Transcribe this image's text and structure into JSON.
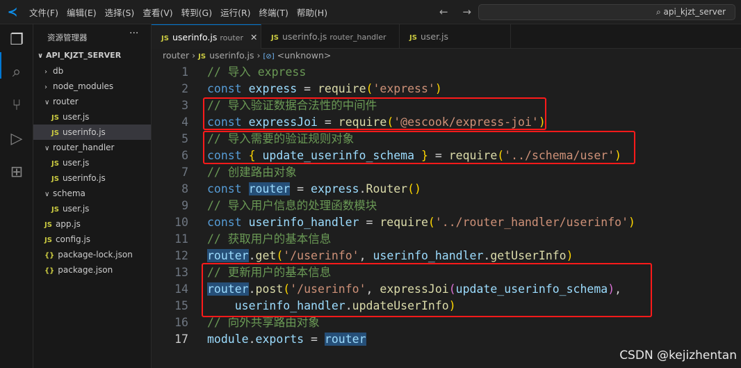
{
  "menu": [
    "文件(F)",
    "编辑(E)",
    "选择(S)",
    "查看(V)",
    "转到(G)",
    "运行(R)",
    "终端(T)",
    "帮助(H)"
  ],
  "search": "⌕ api_kjzt_server",
  "nav": "← →",
  "sidebar": {
    "title": "资源管理器",
    "more": "···",
    "root": "API_KJZT_SERVER",
    "items": [
      {
        "label": "db",
        "type": "folder",
        "open": false,
        "depth": 1
      },
      {
        "label": "node_modules",
        "type": "folder",
        "open": false,
        "depth": 1
      },
      {
        "label": "router",
        "type": "folder",
        "open": true,
        "depth": 1
      },
      {
        "label": "user.js",
        "type": "js",
        "depth": 2
      },
      {
        "label": "userinfo.js",
        "type": "js",
        "depth": 2,
        "selected": true
      },
      {
        "label": "router_handler",
        "type": "folder",
        "open": true,
        "depth": 1
      },
      {
        "label": "user.js",
        "type": "js",
        "depth": 2
      },
      {
        "label": "userinfo.js",
        "type": "js",
        "depth": 2
      },
      {
        "label": "schema",
        "type": "folder",
        "open": true,
        "depth": 1
      },
      {
        "label": "user.js",
        "type": "js",
        "depth": 2
      },
      {
        "label": "app.js",
        "type": "js",
        "depth": 1
      },
      {
        "label": "config.js",
        "type": "js",
        "depth": 1
      },
      {
        "label": "package-lock.json",
        "type": "json",
        "depth": 1
      },
      {
        "label": "package.json",
        "type": "json",
        "depth": 1
      }
    ]
  },
  "tabs": [
    {
      "name": "userinfo.js",
      "desc": "router",
      "active": true,
      "close": "✕"
    },
    {
      "name": "userinfo.js",
      "desc": "router_handler",
      "active": false
    },
    {
      "name": "user.js",
      "desc": "",
      "active": false
    }
  ],
  "breadcrumb": {
    "folder": "router",
    "file": "userinfo.js",
    "symbol": "<unknown>"
  },
  "current_line": 17,
  "code": [
    [
      [
        "c",
        "// 导入 express"
      ]
    ],
    [
      [
        "k",
        "const"
      ],
      [
        "p",
        " "
      ],
      [
        "v",
        "express"
      ],
      [
        "p",
        " = "
      ],
      [
        "f",
        "require"
      ],
      [
        "b",
        "("
      ],
      [
        "s",
        "'express'"
      ],
      [
        "b",
        ")"
      ]
    ],
    [
      [
        "c",
        "// 导入验证数据合法性的中间件"
      ]
    ],
    [
      [
        "k",
        "const"
      ],
      [
        "p",
        " "
      ],
      [
        "v",
        "expressJoi"
      ],
      [
        "p",
        " = "
      ],
      [
        "f",
        "require"
      ],
      [
        "b",
        "("
      ],
      [
        "s",
        "'@escook/express-joi'"
      ],
      [
        "b",
        ")"
      ]
    ],
    [
      [
        "c",
        "// 导入需要的验证规则对象"
      ]
    ],
    [
      [
        "k",
        "const"
      ],
      [
        "p",
        " "
      ],
      [
        "b",
        "{"
      ],
      [
        "p",
        " "
      ],
      [
        "v",
        "update_userinfo_schema"
      ],
      [
        "p",
        " "
      ],
      [
        "b",
        "}"
      ],
      [
        "p",
        " = "
      ],
      [
        "f",
        "require"
      ],
      [
        "b",
        "("
      ],
      [
        "s",
        "'../schema/user'"
      ],
      [
        "b",
        ")"
      ]
    ],
    [
      [
        "c",
        "// 创建路由对象"
      ]
    ],
    [
      [
        "k",
        "const"
      ],
      [
        "p",
        " "
      ],
      [
        "v hl",
        "router"
      ],
      [
        "p",
        " = "
      ],
      [
        "v",
        "express"
      ],
      [
        "p",
        "."
      ],
      [
        "f",
        "Router"
      ],
      [
        "b",
        "()"
      ]
    ],
    [
      [
        "c",
        "// 导入用户信息的处理函数模块"
      ]
    ],
    [
      [
        "k",
        "const"
      ],
      [
        "p",
        " "
      ],
      [
        "v",
        "userinfo_handler"
      ],
      [
        "p",
        " = "
      ],
      [
        "f",
        "require"
      ],
      [
        "b",
        "("
      ],
      [
        "s",
        "'../router_handler/userinfo'"
      ],
      [
        "b",
        ")"
      ]
    ],
    [
      [
        "c",
        "// 获取用户的基本信息"
      ]
    ],
    [
      [
        "v hl",
        "router"
      ],
      [
        "p",
        "."
      ],
      [
        "f",
        "get"
      ],
      [
        "b",
        "("
      ],
      [
        "s",
        "'/userinfo'"
      ],
      [
        "p",
        ", "
      ],
      [
        "v",
        "userinfo_handler"
      ],
      [
        "p",
        "."
      ],
      [
        "f",
        "getUserInfo"
      ],
      [
        "b",
        ")"
      ]
    ],
    [
      [
        "c",
        "// 更新用户的基本信息"
      ]
    ],
    [
      [
        "v hl",
        "router"
      ],
      [
        "p",
        "."
      ],
      [
        "f",
        "post"
      ],
      [
        "b",
        "("
      ],
      [
        "s",
        "'/userinfo'"
      ],
      [
        "p",
        ", "
      ],
      [
        "f",
        "expressJoi"
      ],
      [
        "b2",
        "("
      ],
      [
        "v",
        "update_userinfo_schema"
      ],
      [
        "b2",
        ")"
      ],
      [
        "p",
        ","
      ]
    ],
    [
      [
        "p",
        "    "
      ],
      [
        "v",
        "userinfo_handler"
      ],
      [
        "p",
        "."
      ],
      [
        "f",
        "updateUserInfo"
      ],
      [
        "b",
        ")"
      ]
    ],
    [
      [
        "c",
        "// 向外共享路由对象"
      ]
    ],
    [
      [
        "v",
        "module"
      ],
      [
        "p",
        "."
      ],
      [
        "v",
        "exports"
      ],
      [
        "p",
        " = "
      ],
      [
        "v hl",
        "router"
      ]
    ]
  ],
  "colors": {
    "annotation_box": "#ff1a1a",
    "accent": "#0078d4"
  },
  "watermark": "CSDN @kejizhentan"
}
